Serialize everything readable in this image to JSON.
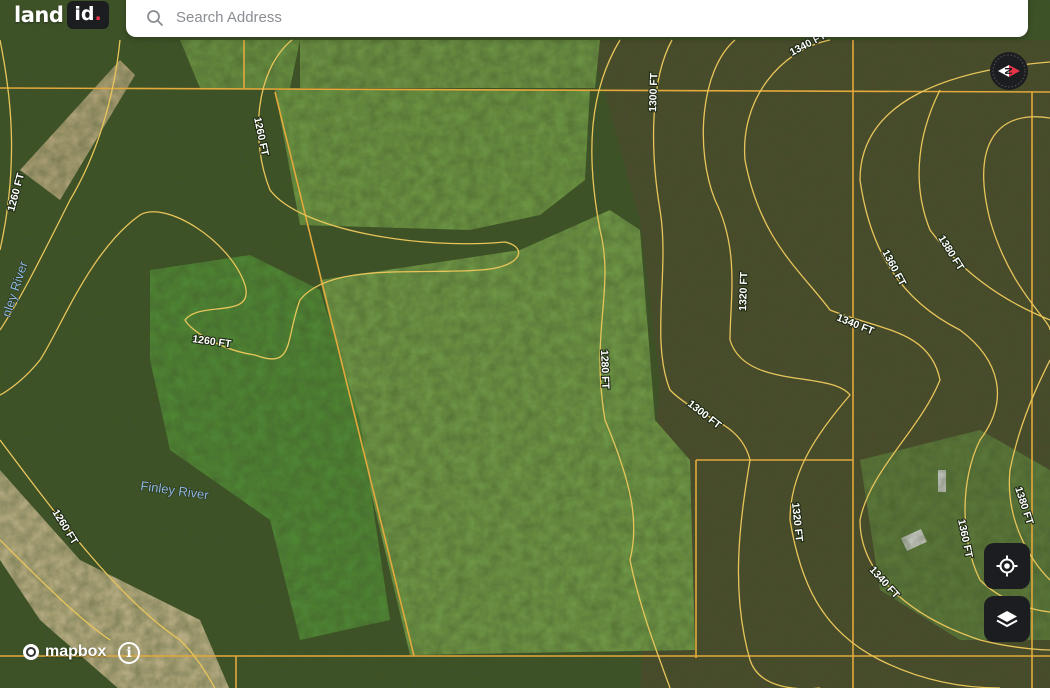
{
  "app": {
    "logo_part1": "land",
    "logo_part2": "id",
    "logo_dot": "."
  },
  "search": {
    "placeholder": "Search Address"
  },
  "map": {
    "attribution": "mapbox",
    "info_symbol": "i",
    "compass_letter": "N",
    "contour_labels": [
      {
        "id": "c1260_left_top",
        "text": "1260 FT"
      },
      {
        "id": "c1260_field_top",
        "text": "1260 FT"
      },
      {
        "id": "c1260_loop",
        "text": "1260 FT"
      },
      {
        "id": "c1260_bottom_left",
        "text": "1260 FT"
      },
      {
        "id": "c1280",
        "text": "1280 FT"
      },
      {
        "id": "c1300_top",
        "text": "1300 FT"
      },
      {
        "id": "c1300_mid",
        "text": "1300 FT"
      },
      {
        "id": "c1320_mid",
        "text": "1320 FT"
      },
      {
        "id": "c1320_bottom",
        "text": "1320 FT"
      },
      {
        "id": "c1340_top",
        "text": "1340 FT"
      },
      {
        "id": "c1340_mid",
        "text": "1340 FT"
      },
      {
        "id": "c1340_bottom",
        "text": "1340 FT"
      },
      {
        "id": "c1360_upper",
        "text": "1360 FT"
      },
      {
        "id": "c1360_lower",
        "text": "1360 FT"
      },
      {
        "id": "c1380_upper",
        "text": "1380 FT"
      },
      {
        "id": "c1380_lower",
        "text": "1380 FT"
      }
    ],
    "place_labels": [
      {
        "id": "finley_river_main",
        "text": "Finley River"
      },
      {
        "id": "finley_river_side",
        "text": "nley River"
      }
    ]
  },
  "controls": {
    "locate_icon": "crosshair-icon",
    "layers_icon": "layers-icon"
  },
  "colors": {
    "contour": "#e8c55a",
    "parcel_line": "#e3a93c",
    "river_label": "#8fb8e0",
    "control_bg": "#1b1d21",
    "logo_dot": "#e8344a"
  }
}
